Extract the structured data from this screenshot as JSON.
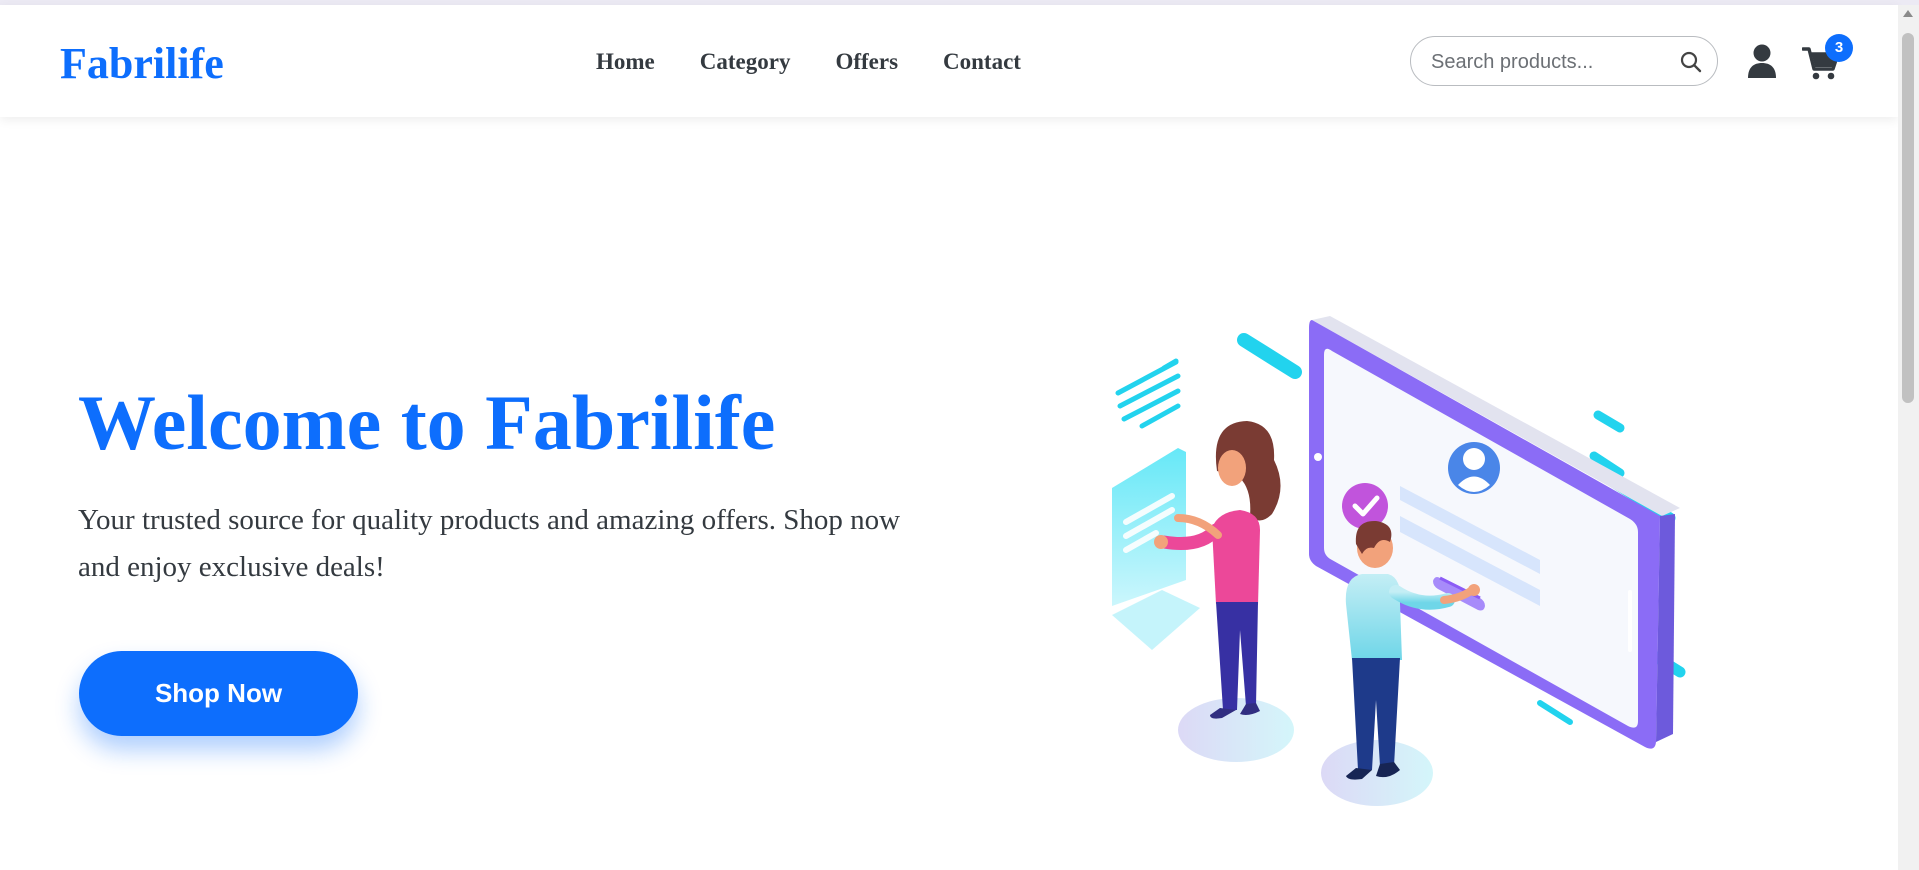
{
  "brand": {
    "name": "Fabrilife",
    "color": "#0d6efd"
  },
  "nav": {
    "items": [
      "Home",
      "Category",
      "Offers",
      "Contact"
    ]
  },
  "search": {
    "placeholder": "Search products...",
    "icon": "search-icon"
  },
  "header_icons": {
    "user": "user-icon",
    "cart": "cart-icon",
    "cart_count": "3"
  },
  "hero": {
    "title": "Welcome to Fabrilife",
    "description": "Your trusted source for quality products and amazing offers. Shop now and enjoy exclusive deals!",
    "cta_label": "Shop Now",
    "illustration": "people-using-tablet-illustration"
  },
  "colors": {
    "accent": "#0d6efd",
    "text": "#343a40",
    "illustration_purple": "#8b6cf6",
    "illustration_cyan": "#22d3ee",
    "illustration_pink": "#ec4899"
  }
}
